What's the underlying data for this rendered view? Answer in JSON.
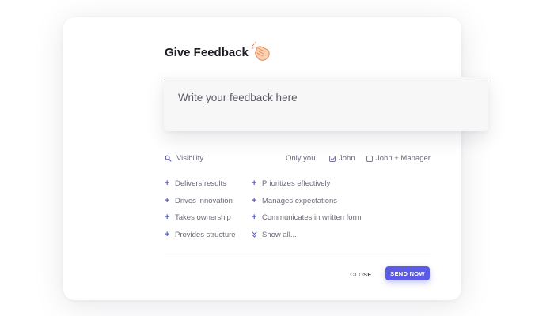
{
  "header": {
    "title": "Give Feedback",
    "emoji_icon": "clapping-hands-icon"
  },
  "feedback": {
    "placeholder": "Write your feedback here",
    "value": ""
  },
  "visibility": {
    "label": "Visibility",
    "icon": "visibility-search-icon",
    "options": [
      {
        "label": "Only you",
        "selected": false
      },
      {
        "label": "John",
        "selected": true
      },
      {
        "label": "John + Manager",
        "selected": false
      }
    ]
  },
  "traits": {
    "left": [
      "Delivers results",
      "Drives innovation",
      "Takes ownership",
      "Provides structure"
    ],
    "right": [
      "Prioritizes effectively",
      "Manages expectations",
      "Communicates in written form"
    ],
    "show_all": "Show all..."
  },
  "actions": {
    "close": "CLOSE",
    "send": "SEND NOW"
  },
  "colors": {
    "accent": "#5b5be8",
    "text": "#1c1c24",
    "muted": "#6a6a78",
    "clap": "#f4a06a"
  }
}
